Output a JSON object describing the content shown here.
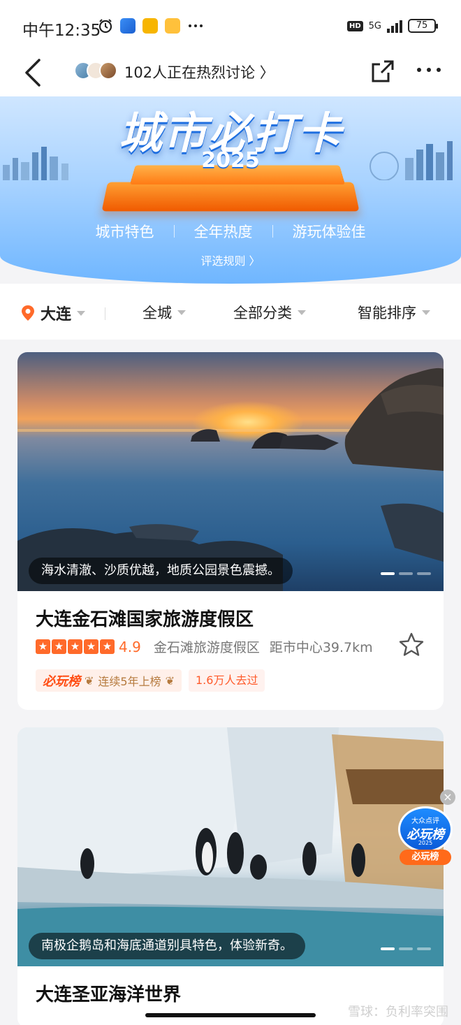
{
  "status_bar": {
    "time": "中午12:35",
    "network": "5G",
    "hd": "HD",
    "battery": "75"
  },
  "nav": {
    "discuss_text": "102人正在热烈讨论 〉"
  },
  "banner": {
    "title": "城市必打卡",
    "year": "2025",
    "tags": [
      "城市特色",
      "全年热度",
      "游玩体验佳"
    ],
    "rules_link": "评选规则 〉"
  },
  "filters": {
    "city": "大连",
    "area": "全城",
    "category": "全部分类",
    "sort": "智能排序"
  },
  "cards": [
    {
      "caption": "海水清澈、沙质优越，地质公园景色震撼。",
      "title": "大连金石滩国家旅游度假区",
      "score": "4.9",
      "location": "金石滩旅游度假区",
      "distance": "距市中心39.7km",
      "rating_stars": 5,
      "badge_logo": "必玩榜",
      "badge_text": "连续5年上榜",
      "visited": "1.6万人去过"
    },
    {
      "caption": "南极企鹅岛和海底通道别具特色，体验新奇。",
      "title": "大连圣亚海洋世界"
    }
  ],
  "floating_badge": {
    "brand": "大众点评",
    "main": "必玩榜",
    "year": "2025",
    "ribbon": "必玩榜"
  },
  "watermark": "雪球：负利率突围",
  "colors": {
    "accent": "#ff6a2a",
    "banner_blue": "#6fb6ff",
    "podium_orange": "#ff7a14"
  }
}
